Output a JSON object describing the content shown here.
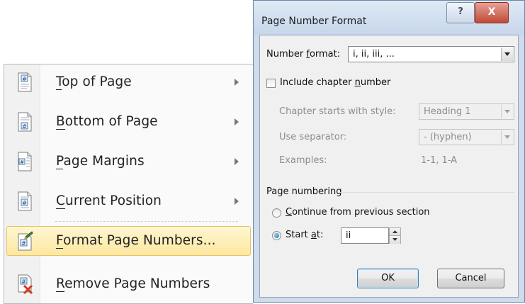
{
  "menu": {
    "items": [
      {
        "pre": "",
        "key": "T",
        "post": "op of Page",
        "has_submenu": true,
        "icon": "top-of-page-icon"
      },
      {
        "pre": "",
        "key": "B",
        "post": "ottom of Page",
        "has_submenu": true,
        "icon": "bottom-of-page-icon"
      },
      {
        "pre": "",
        "key": "P",
        "post": "age Margins",
        "has_submenu": true,
        "icon": "page-margins-icon"
      },
      {
        "pre": "",
        "key": "C",
        "post": "urrent Position",
        "has_submenu": true,
        "icon": "current-position-icon"
      },
      {
        "pre": "",
        "key": "F",
        "post": "ormat Page Numbers...",
        "has_submenu": false,
        "highlighted": true,
        "icon": "format-page-numbers-icon"
      },
      {
        "pre": "",
        "key": "R",
        "post": "emove Page Numbers",
        "has_submenu": false,
        "icon": "remove-page-numbers-icon"
      }
    ],
    "highlight_color": "#fde8a0"
  },
  "dialog": {
    "title": "Page Number Format",
    "help_glyph": "?",
    "close_glyph": "X",
    "number_format": {
      "pre": "Number ",
      "key": "f",
      "post": "ormat:",
      "value": "i, ii, iii, ..."
    },
    "include_chapter": {
      "pre": "Include chapter ",
      "key": "n",
      "post": "umber",
      "checked": false
    },
    "chapter_style": {
      "label": "Chapter starts with style:",
      "value": "Heading 1"
    },
    "separator": {
      "label": "Use separator:",
      "value": "-  (hyphen)"
    },
    "examples": {
      "label": "Examples:",
      "value": "1-1, 1-A"
    },
    "page_numbering": {
      "label": "Page numbering",
      "continue": {
        "pre": "",
        "key": "C",
        "post": "ontinue from previous section",
        "selected": false
      },
      "start_at": {
        "pre": "Start ",
        "key": "a",
        "post": "t:",
        "selected": true,
        "value": "ii"
      }
    },
    "ok_label": "OK",
    "cancel_label": "Cancel"
  }
}
